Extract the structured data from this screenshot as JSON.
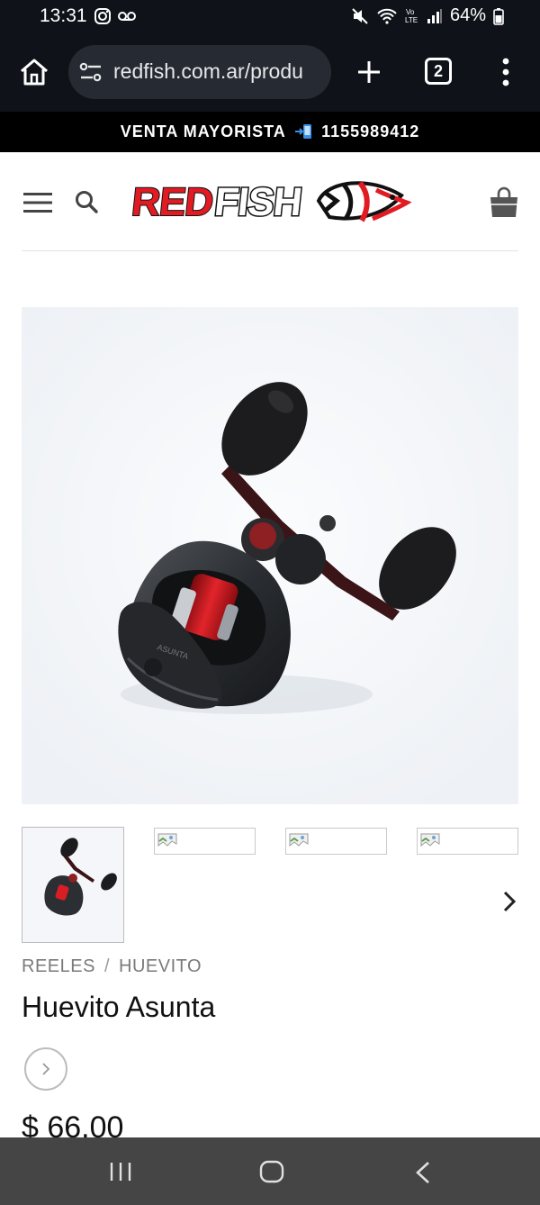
{
  "status_bar": {
    "time": "13:31",
    "battery": "64%",
    "left_icons": [
      "instagram-icon",
      "voicemail-icon"
    ],
    "right_icons": [
      "mute-icon",
      "wifi-icon",
      "volte-icon",
      "signal-icon",
      "battery-icon"
    ]
  },
  "browser": {
    "url": "redfish.com.ar/produ",
    "tab_count": "2"
  },
  "announcement": {
    "text_before": "VENTA MAYORISTA",
    "icon": "arrow-phone-icon",
    "phone": "1155989412"
  },
  "header": {
    "logo": "REDFISH"
  },
  "product": {
    "breadcrumb": [
      "REELES",
      "HUEVITO"
    ],
    "breadcrumb_sep": "/",
    "title": "Huevito Asunta",
    "price": "$ 66.00",
    "thumbnail_count": 4
  },
  "colors": {
    "brand_red": "#e21b23",
    "reel_red": "#d0141a",
    "dark_bar": "#0f1319",
    "nav_bar": "#454545"
  }
}
